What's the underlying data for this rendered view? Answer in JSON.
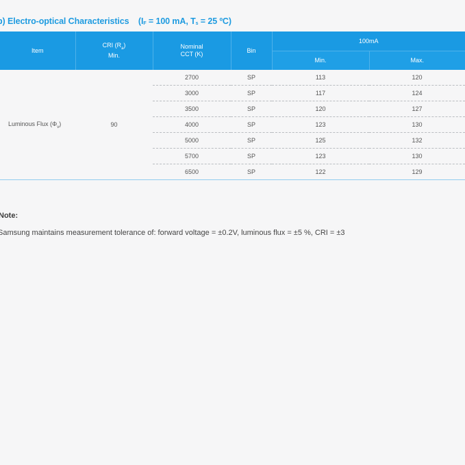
{
  "section": {
    "number": "b)",
    "title": "Electro-optical Characteristics",
    "condition": "(I",
    "condition_sub1": "F",
    "condition_mid": " = 100 mA, T",
    "condition_sub2": "s",
    "condition_end": " = 25 ºC)"
  },
  "table": {
    "headers": {
      "item": "Item",
      "cri_line1": "CRI (R",
      "cri_sub": "a",
      "cri_line1_end": ")",
      "cri_line2": "Min.",
      "cct_line1": "Nominal",
      "cct_line2": "CCT (K)",
      "bin": "Bin",
      "group": "100mA",
      "min": "Min.",
      "max": "Max."
    },
    "item_label": "Luminous Flux (Φ",
    "item_sub": "v",
    "item_label_end": ")",
    "cri_value": "90",
    "rows": [
      {
        "cct": "2700",
        "bin": "SP",
        "min": "113",
        "max": "120"
      },
      {
        "cct": "3000",
        "bin": "SP",
        "min": "117",
        "max": "124"
      },
      {
        "cct": "3500",
        "bin": "SP",
        "min": "120",
        "max": "127"
      },
      {
        "cct": "4000",
        "bin": "SP",
        "min": "123",
        "max": "130"
      },
      {
        "cct": "5000",
        "bin": "SP",
        "min": "125",
        "max": "132"
      },
      {
        "cct": "5700",
        "bin": "SP",
        "min": "123",
        "max": "130"
      },
      {
        "cct": "6500",
        "bin": "SP",
        "min": "122",
        "max": "129"
      }
    ]
  },
  "note": {
    "title": "Note:",
    "text": "Samsung maintains measurement tolerance of: forward voltage =  ±0.2V, luminous flux = ±5 %, CRI =  ±3"
  },
  "colors": {
    "accent": "#1a9ae3",
    "title": "#1e9be0",
    "background": "#f6f6f7"
  }
}
